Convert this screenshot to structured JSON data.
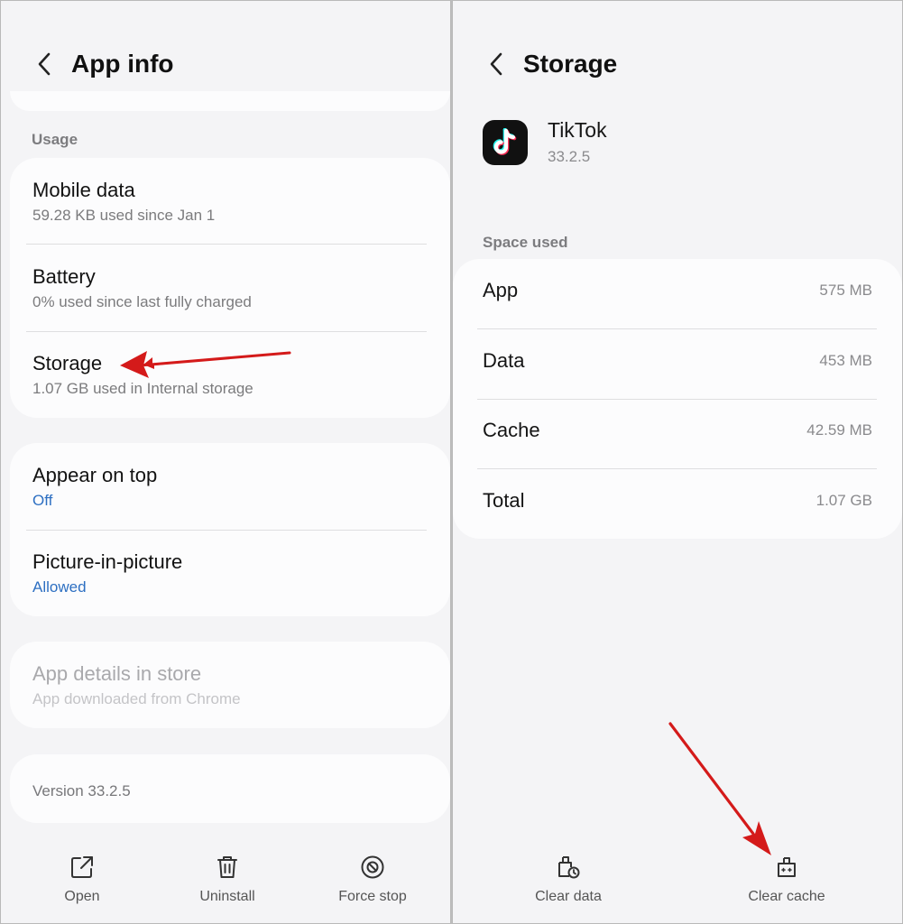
{
  "left": {
    "title": "App info",
    "usage_label": "Usage",
    "usage_items": [
      {
        "title": "Mobile data",
        "sub": "59.28 KB used since Jan 1"
      },
      {
        "title": "Battery",
        "sub": "0% used since last fully charged"
      },
      {
        "title": "Storage",
        "sub": "1.07 GB used in Internal storage"
      }
    ],
    "perm_items": [
      {
        "title": "Appear on top",
        "sub": "Off"
      },
      {
        "title": "Picture-in-picture",
        "sub": "Allowed"
      }
    ],
    "store_item": {
      "title": "App details in store",
      "sub": "App downloaded from Chrome"
    },
    "version": "Version 33.2.5",
    "bottom": [
      {
        "label": "Open",
        "icon": "open-external-icon"
      },
      {
        "label": "Uninstall",
        "icon": "trash-icon"
      },
      {
        "label": "Force stop",
        "icon": "stop-icon"
      }
    ]
  },
  "right": {
    "title": "Storage",
    "app_name": "TikTok",
    "app_version": "33.2.5",
    "space_label": "Space used",
    "rows": [
      {
        "key": "App",
        "value": "575 MB"
      },
      {
        "key": "Data",
        "value": "453 MB"
      },
      {
        "key": "Cache",
        "value": "42.59 MB"
      },
      {
        "key": "Total",
        "value": "1.07 GB"
      }
    ],
    "bottom": [
      {
        "label": "Clear data",
        "icon": "clear-data-icon"
      },
      {
        "label": "Clear cache",
        "icon": "clear-cache-icon"
      }
    ]
  },
  "colors": {
    "accent_blue": "#2d6fc2",
    "annotation_red": "#d41a1a",
    "background": "#f4f4f6"
  }
}
